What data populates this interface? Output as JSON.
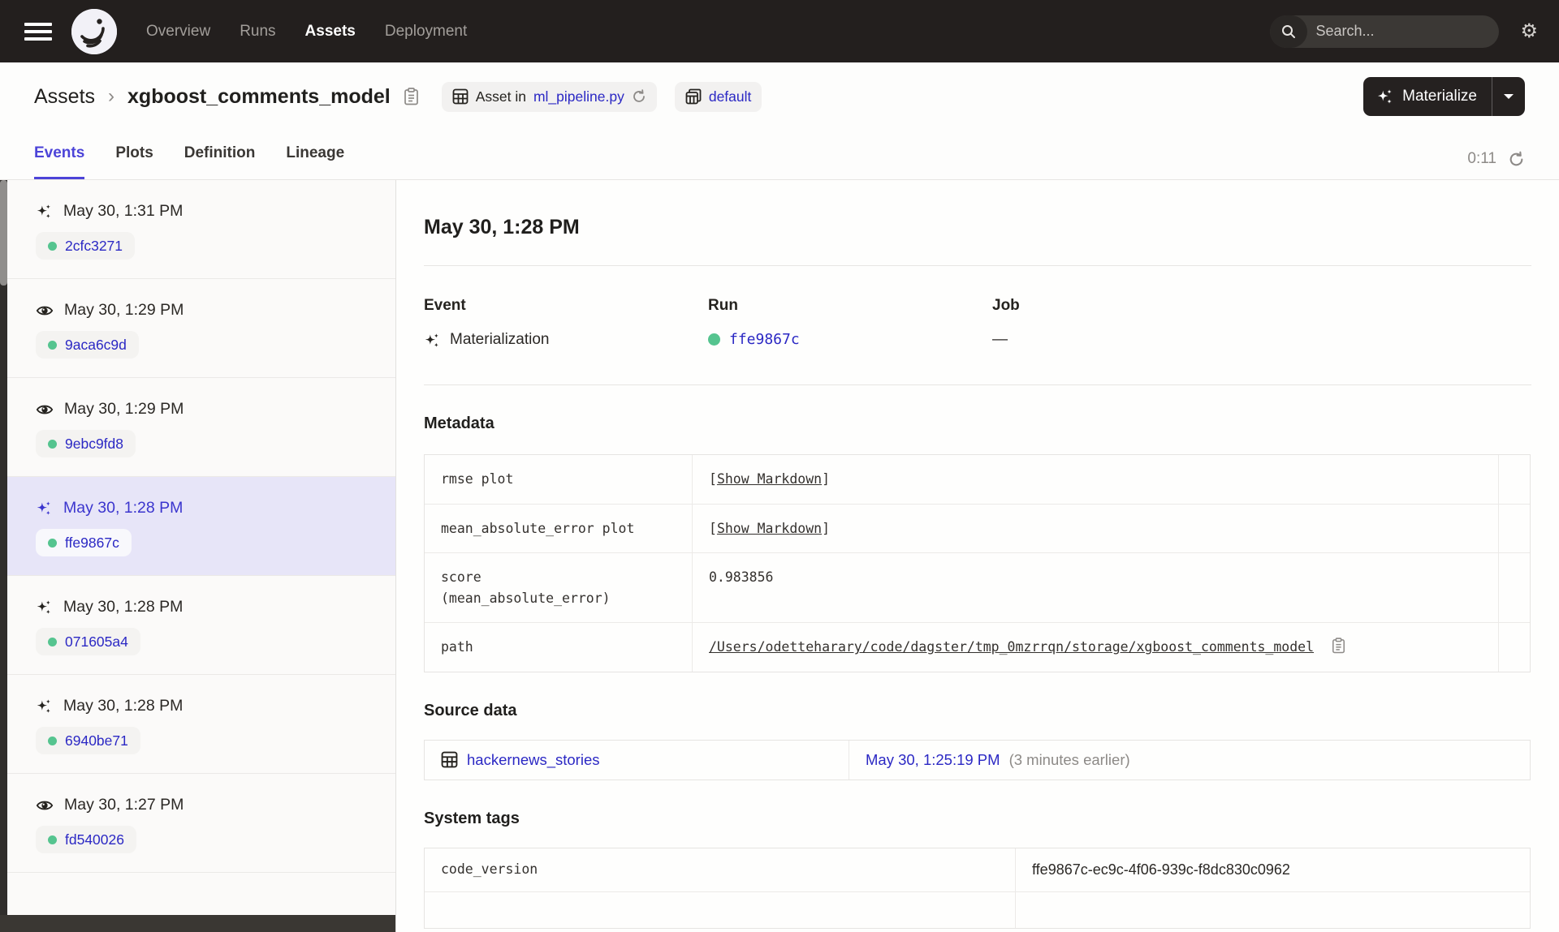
{
  "colors": {
    "accent": "#4C44D8",
    "link": "#2B28C4",
    "success_green": "#55C48F",
    "topbar_bg": "#231F1E",
    "selected_bg": "#E7E5F8"
  },
  "icons": {
    "gear": "⚙",
    "caret_down": "▾",
    "chevron": "›"
  },
  "header": {
    "nav": [
      {
        "label": "Overview",
        "active": false
      },
      {
        "label": "Runs",
        "active": false
      },
      {
        "label": "Assets",
        "active": true
      },
      {
        "label": "Deployment",
        "active": false
      }
    ],
    "search": {
      "placeholder": "Search...",
      "shortcut": "/"
    }
  },
  "breadcrumb": {
    "root": "Assets",
    "separator": "›",
    "title": "xgboost_comments_model"
  },
  "context": {
    "asset_in": {
      "prefix": "Asset in",
      "file": "ml_pipeline.py"
    },
    "repo": {
      "label": "default"
    }
  },
  "materialize": {
    "label": "Materialize"
  },
  "tabs": [
    {
      "label": "Events",
      "active": true
    },
    {
      "label": "Plots",
      "active": false
    },
    {
      "label": "Definition",
      "active": false
    },
    {
      "label": "Lineage",
      "active": false
    }
  ],
  "refresh": {
    "countdown": "0:11"
  },
  "sidebar": {
    "items": [
      {
        "type": "materialization",
        "time": "May 30, 1:31 PM",
        "run_id": "2cfc3271",
        "selected": false
      },
      {
        "type": "observation",
        "time": "May 30, 1:29 PM",
        "run_id": "9aca6c9d",
        "selected": false
      },
      {
        "type": "observation",
        "time": "May 30, 1:29 PM",
        "run_id": "9ebc9fd8",
        "selected": false
      },
      {
        "type": "materialization",
        "time": "May 30, 1:28 PM",
        "run_id": "ffe9867c",
        "selected": true
      },
      {
        "type": "materialization",
        "time": "May 30, 1:28 PM",
        "run_id": "071605a4",
        "selected": false
      },
      {
        "type": "materialization",
        "time": "May 30, 1:28 PM",
        "run_id": "6940be71",
        "selected": false
      },
      {
        "type": "observation",
        "time": "May 30, 1:27 PM",
        "run_id": "fd540026",
        "selected": false
      }
    ]
  },
  "detail": {
    "title": "May 30, 1:28 PM",
    "event": {
      "label": "Event",
      "value": "Materialization"
    },
    "run": {
      "label": "Run",
      "value": "ffe9867c"
    },
    "job": {
      "label": "Job",
      "value": "—"
    },
    "metadata": {
      "heading": "Metadata",
      "bracket_open": "[",
      "bracket_close": "]",
      "rows": [
        {
          "key": "rmse plot",
          "link": "Show Markdown"
        },
        {
          "key": "mean_absolute_error plot",
          "link": "Show Markdown"
        },
        {
          "key": "score",
          "key2": "(mean_absolute_error)",
          "value": "0.983856"
        },
        {
          "key": "path",
          "path": "/Users/odetteharary/code/dagster/tmp_0mzrrqn/storage/xgboost_comments_model"
        }
      ]
    },
    "source_data": {
      "heading": "Source data",
      "asset": "hackernews_stories",
      "timestamp": "May 30, 1:25:19 PM",
      "note": "(3 minutes earlier)"
    },
    "system_tags": {
      "heading": "System tags",
      "rows": [
        {
          "key": "code_version",
          "value": "ffe9867c-ec9c-4f06-939c-f8dc830c0962"
        }
      ]
    }
  }
}
